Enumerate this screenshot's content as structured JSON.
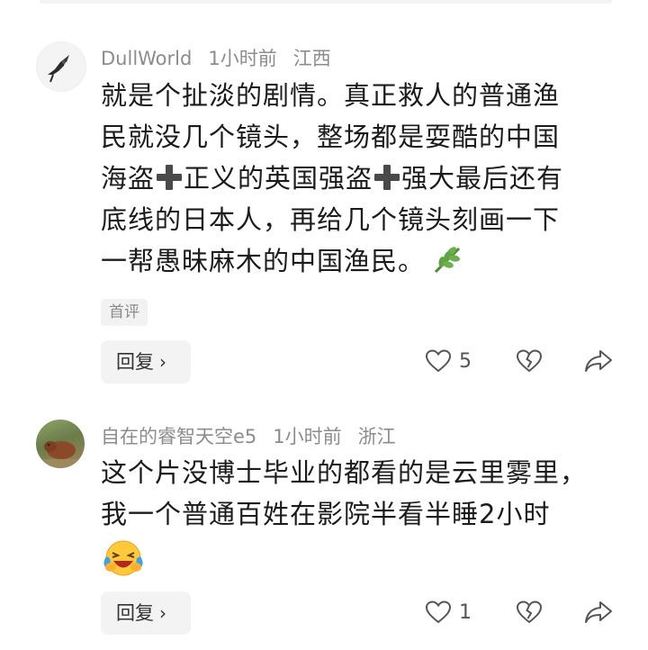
{
  "comments": [
    {
      "username": "DullWorld",
      "time": "1小时前",
      "location": "江西",
      "lines": [
        "就是个扯淡的剧情。真正救人的普通渔",
        "民就没几个镜头，整场都是耍酷的中国",
        [
          "海盗",
          "正义的英国强盗",
          "强大最后还有"
        ],
        "底线的日本人，再给几个镜头刻画一下",
        "一帮愚昧麻木的中国渔民。"
      ],
      "tag": "首评",
      "reply_label": "回复",
      "like_count": "5",
      "trailing_emoji": "herb-emoji"
    },
    {
      "username": "自在的睿智天空e5",
      "time": "1小时前",
      "location": "浙江",
      "lines": [
        "这个片没博士毕业的都看的是云里雾里，",
        "我一个普通百姓在影院半看半睡2小时"
      ],
      "reply_label": "回复",
      "like_count": "1",
      "trailing_emoji": "laughing-crying-emoji"
    }
  ],
  "icons": {
    "like": "heart-outline-icon",
    "dislike": "broken-heart-icon",
    "share": "share-arrow-icon",
    "plus": "heavy-plus-emoji"
  }
}
